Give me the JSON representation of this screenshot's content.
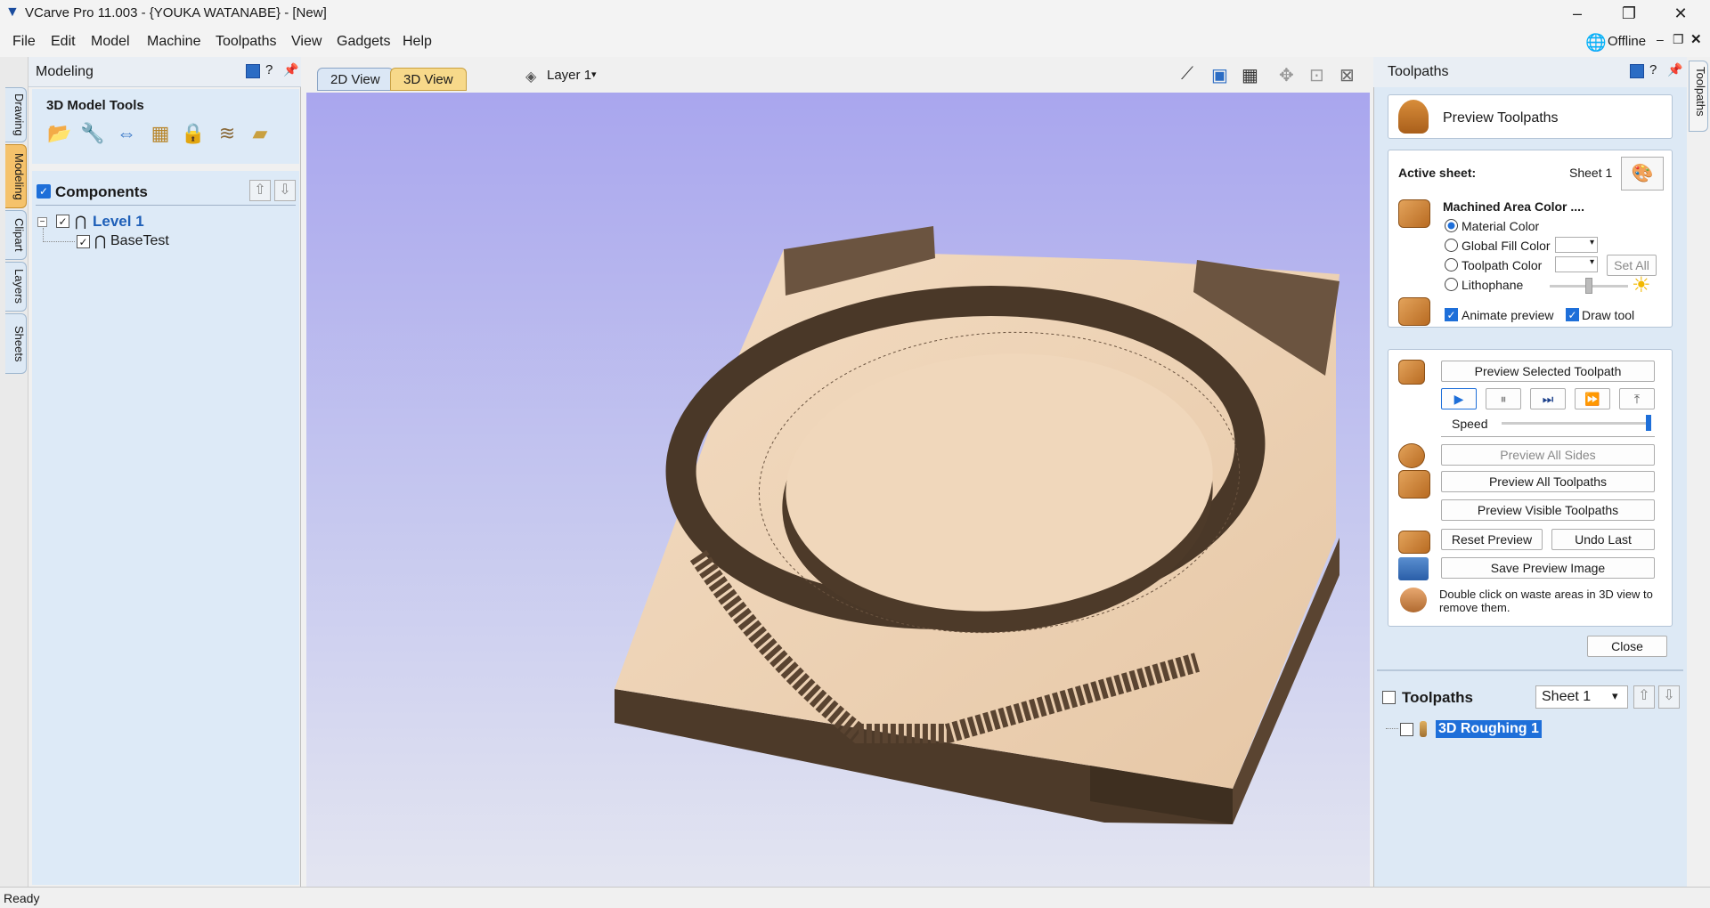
{
  "window": {
    "title": "VCarve Pro 11.003 - {YOUKA WATANABE} - [New]"
  },
  "menu": [
    "File",
    "Edit",
    "Model",
    "Machine",
    "Toolpaths",
    "View",
    "Gadgets",
    "Help"
  ],
  "status_top": {
    "offline": "Offline"
  },
  "left_tabs": [
    "Drawing",
    "Modeling",
    "Clipart",
    "Layers",
    "Sheets"
  ],
  "left_panel": {
    "title": "Modeling",
    "tools_title": "3D Model Tools",
    "components_label": "Components",
    "tree": {
      "level": "Level 1",
      "item": "BaseTest"
    }
  },
  "view": {
    "tab_2d": "2D View",
    "tab_3d": "3D View",
    "layer": "Layer 1"
  },
  "right_panel": {
    "title": "Toolpaths",
    "side_tab": "Toolpaths",
    "preview_title": "Preview Toolpaths",
    "active_sheet_label": "Active sheet:",
    "active_sheet_value": "Sheet 1",
    "machined_area": "Machined Area Color ....",
    "opt_material": "Material Color",
    "opt_global": "Global Fill Color",
    "opt_toolpath": "Toolpath Color",
    "opt_litho": "Lithophane",
    "set_all": "Set All",
    "animate": "Animate preview",
    "draw_tool": "Draw tool",
    "btn_preview_selected": "Preview Selected Toolpath",
    "speed": "Speed",
    "btn_all_sides": "Preview All Sides",
    "btn_all_toolpaths": "Preview All Toolpaths",
    "btn_visible": "Preview Visible Toolpaths",
    "btn_reset": "Reset Preview",
    "btn_undo": "Undo Last",
    "btn_save_img": "Save Preview Image",
    "hint": "Double click on waste areas in 3D view to remove them.",
    "btn_close": "Close",
    "list_title": "Toolpaths",
    "sheet_select": "Sheet 1",
    "toolpath_item": "3D Roughing 1"
  },
  "statusbar": {
    "text": "Ready"
  }
}
